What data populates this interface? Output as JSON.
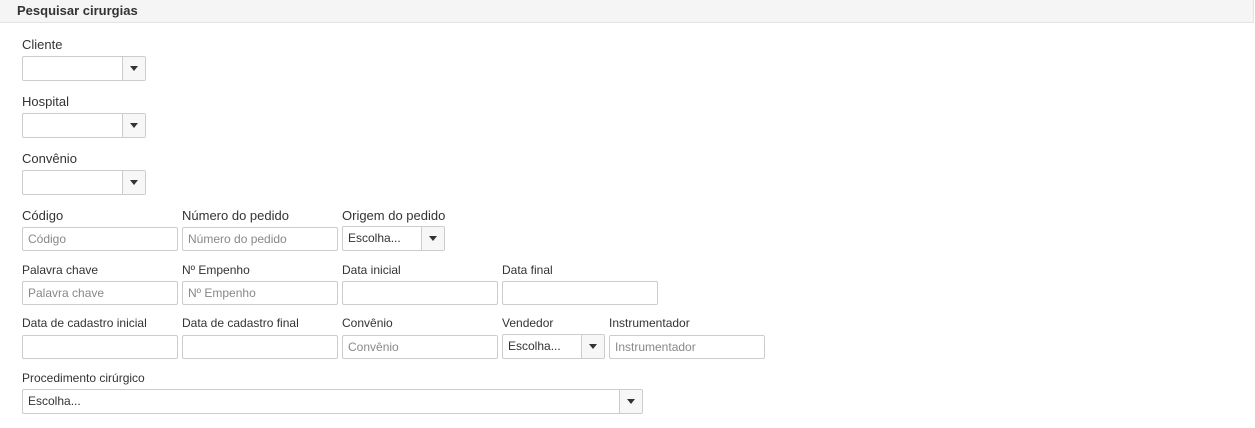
{
  "panel": {
    "title": "Pesquisar cirurgias"
  },
  "fields": {
    "cliente": {
      "label": "Cliente",
      "value": ""
    },
    "hospital": {
      "label": "Hospital",
      "value": ""
    },
    "convenio_select": {
      "label": "Convênio",
      "value": ""
    },
    "codigo": {
      "label": "Código",
      "placeholder": "Código"
    },
    "numero_pedido": {
      "label": "Número do pedido",
      "placeholder": "Número do pedido"
    },
    "origem_pedido": {
      "label": "Origem do pedido",
      "value": "Escolha..."
    },
    "palavra_chave": {
      "label": "Palavra chave",
      "placeholder": "Palavra chave"
    },
    "empenho": {
      "label": "Nº Empenho",
      "placeholder": "Nº Empenho"
    },
    "data_inicial": {
      "label": "Data inicial",
      "placeholder": ""
    },
    "data_final": {
      "label": "Data final",
      "placeholder": ""
    },
    "data_cadastro_inicial": {
      "label": "Data de cadastro inicial",
      "placeholder": ""
    },
    "data_cadastro_final": {
      "label": "Data de cadastro final",
      "placeholder": ""
    },
    "convenio_text": {
      "label": "Convênio",
      "placeholder": "Convênio"
    },
    "vendedor": {
      "label": "Vendedor",
      "value": "Escolha..."
    },
    "instrumentador": {
      "label": "Instrumentador",
      "placeholder": "Instrumentador"
    },
    "procedimento": {
      "label": "Procedimento cirúrgico",
      "value": "Escolha..."
    }
  },
  "icons": {
    "dropdown": "caret-down-icon"
  }
}
